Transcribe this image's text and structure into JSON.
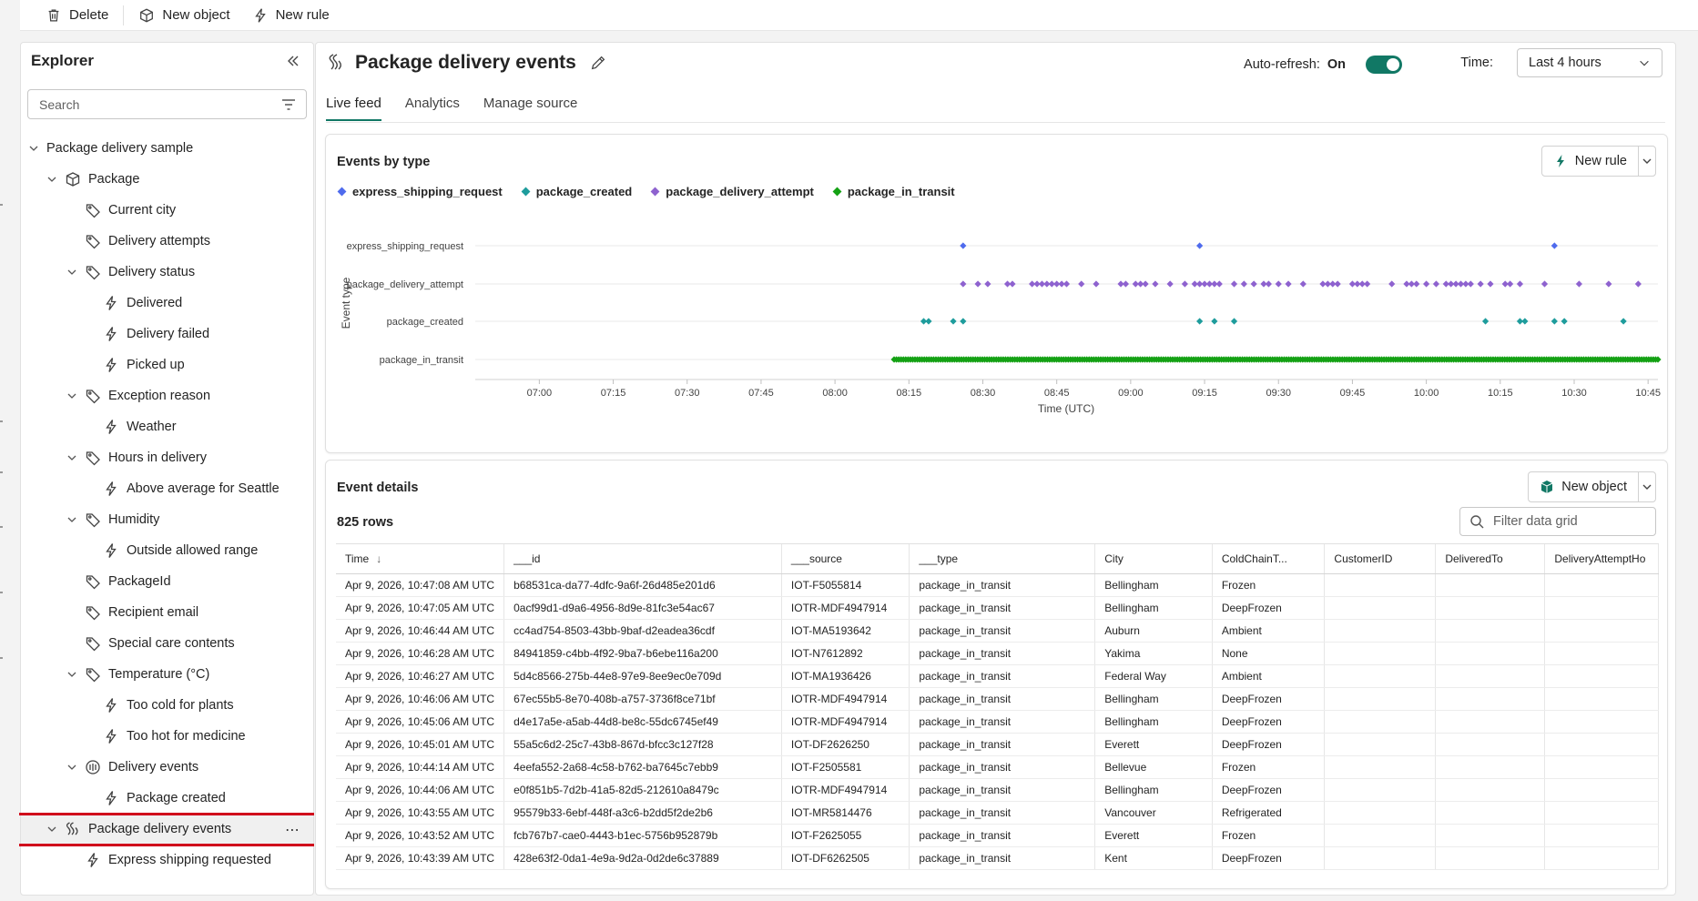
{
  "toolbar": {
    "delete": "Delete",
    "new_object": "New object",
    "new_rule": "New rule"
  },
  "explorer": {
    "title": "Explorer",
    "search_placeholder": "Search",
    "tree": [
      {
        "label": "Package delivery sample",
        "level": 0,
        "chevron": "down",
        "icon": ""
      },
      {
        "label": "Package",
        "level": 1,
        "chevron": "down",
        "icon": "cube-icon"
      },
      {
        "label": "Current city",
        "level": 2,
        "chevron": "",
        "icon": "tag-icon"
      },
      {
        "label": "Delivery attempts",
        "level": 2,
        "chevron": "",
        "icon": "tag-icon"
      },
      {
        "label": "Delivery status",
        "level": 2,
        "chevron": "down",
        "icon": "tag-icon"
      },
      {
        "label": "Delivered",
        "level": 3,
        "chevron": "",
        "icon": "lightning-icon"
      },
      {
        "label": "Delivery failed",
        "level": 3,
        "chevron": "",
        "icon": "lightning-icon"
      },
      {
        "label": "Picked up",
        "level": 3,
        "chevron": "",
        "icon": "lightning-icon"
      },
      {
        "label": "Exception reason",
        "level": 2,
        "chevron": "down",
        "icon": "tag-icon"
      },
      {
        "label": "Weather",
        "level": 3,
        "chevron": "",
        "icon": "lightning-icon"
      },
      {
        "label": "Hours in delivery",
        "level": 2,
        "chevron": "down",
        "icon": "tag-icon"
      },
      {
        "label": "Above average for Seattle",
        "level": 3,
        "chevron": "",
        "icon": "lightning-icon"
      },
      {
        "label": "Humidity",
        "level": 2,
        "chevron": "down",
        "icon": "tag-icon"
      },
      {
        "label": "Outside allowed range",
        "level": 3,
        "chevron": "",
        "icon": "lightning-icon"
      },
      {
        "label": "PackageId",
        "level": 2,
        "chevron": "",
        "icon": "tag-icon"
      },
      {
        "label": "Recipient email",
        "level": 2,
        "chevron": "",
        "icon": "tag-icon"
      },
      {
        "label": "Special care contents",
        "level": 2,
        "chevron": "",
        "icon": "tag-icon"
      },
      {
        "label": "Temperature (°C)",
        "level": 2,
        "chevron": "down",
        "icon": "tag-icon"
      },
      {
        "label": "Too cold for plants",
        "level": 3,
        "chevron": "",
        "icon": "lightning-icon"
      },
      {
        "label": "Too hot for medicine",
        "level": 3,
        "chevron": "",
        "icon": "lightning-icon"
      },
      {
        "label": "Delivery events",
        "level": 2,
        "chevron": "down",
        "icon": "event-stream-icon"
      },
      {
        "label": "Package created",
        "level": 3,
        "chevron": "",
        "icon": "lightning-icon"
      },
      {
        "label": "Package delivery events",
        "level": 1,
        "chevron": "down",
        "icon": "stream-icon",
        "selected": true
      },
      {
        "label": "Express shipping requested",
        "level": 2,
        "chevron": "",
        "icon": "lightning-icon"
      }
    ]
  },
  "main": {
    "title": "Package delivery events",
    "auto_refresh_label": "Auto-refresh:",
    "auto_refresh_value": "On",
    "time_label": "Time:",
    "time_value": "Last 4 hours",
    "tabs": [
      {
        "label": "Live feed",
        "active": true
      },
      {
        "label": "Analytics",
        "active": false
      },
      {
        "label": "Manage source",
        "active": false
      }
    ]
  },
  "events_card": {
    "title": "Events by type",
    "new_rule": "New rule"
  },
  "details_card": {
    "title": "Event details",
    "new_object": "New object",
    "rows_count": "825 rows",
    "filter_placeholder": "Filter data grid",
    "columns": [
      "Time",
      "___id",
      "___source",
      "___type",
      "City",
      "ColdChainT...",
      "CustomerID",
      "DeliveredTo",
      "DeliveryAttemptHo"
    ],
    "rows": [
      [
        "Apr 9, 2026, 10:47:08 AM UTC",
        "b68531ca-da77-4dfc-9a6f-26d485e201d6",
        "IOT-F5055814",
        "package_in_transit",
        "Bellingham",
        "Frozen",
        "",
        "",
        ""
      ],
      [
        "Apr 9, 2026, 10:47:05 AM UTC",
        "0acf99d1-d9a6-4956-8d9e-81fc3e54ac67",
        "IOTR-MDF4947914",
        "package_in_transit",
        "Bellingham",
        "DeepFrozen",
        "",
        "",
        ""
      ],
      [
        "Apr 9, 2026, 10:46:44 AM UTC",
        "cc4ad754-8503-43bb-9baf-d2eadea36cdf",
        "IOT-MA5193642",
        "package_in_transit",
        "Auburn",
        "Ambient",
        "",
        "",
        ""
      ],
      [
        "Apr 9, 2026, 10:46:28 AM UTC",
        "84941859-c4bb-4f92-9ba7-b6ebe116a200",
        "IOT-N7612892",
        "package_in_transit",
        "Yakima",
        "None",
        "",
        "",
        ""
      ],
      [
        "Apr 9, 2026, 10:46:27 AM UTC",
        "5d4c8566-275b-44e8-97e9-8ee9ec0e709d",
        "IOT-MA1936426",
        "package_in_transit",
        "Federal Way",
        "Ambient",
        "",
        "",
        ""
      ],
      [
        "Apr 9, 2026, 10:46:06 AM UTC",
        "67ec55b5-8e70-408b-a757-3736f8ce71bf",
        "IOTR-MDF4947914",
        "package_in_transit",
        "Bellingham",
        "DeepFrozen",
        "",
        "",
        ""
      ],
      [
        "Apr 9, 2026, 10:45:06 AM UTC",
        "d4e17a5e-a5ab-44d8-be8c-55dc6745ef49",
        "IOTR-MDF4947914",
        "package_in_transit",
        "Bellingham",
        "DeepFrozen",
        "",
        "",
        ""
      ],
      [
        "Apr 9, 2026, 10:45:01 AM UTC",
        "55a5c6d2-25c7-43b8-867d-bfcc3c127f28",
        "IOT-DF2626250",
        "package_in_transit",
        "Everett",
        "DeepFrozen",
        "",
        "",
        ""
      ],
      [
        "Apr 9, 2026, 10:44:14 AM UTC",
        "4eefa552-2a68-4c58-b762-ba7645c7ebb9",
        "IOT-F2505581",
        "package_in_transit",
        "Bellevue",
        "Frozen",
        "",
        "",
        ""
      ],
      [
        "Apr 9, 2026, 10:44:06 AM UTC",
        "e0f851b5-7d2b-41a5-82d5-212610a8479c",
        "IOTR-MDF4947914",
        "package_in_transit",
        "Bellingham",
        "DeepFrozen",
        "",
        "",
        ""
      ],
      [
        "Apr 9, 2026, 10:43:55 AM UTC",
        "95579b33-6ebf-448f-a3c6-b2dd5f2de2b6",
        "IOT-MR5814476",
        "package_in_transit",
        "Vancouver",
        "Refrigerated",
        "",
        "",
        ""
      ],
      [
        "Apr 9, 2026, 10:43:52 AM UTC",
        "fcb767b7-cae0-4443-b1ec-5756b952879b",
        "IOT-F2625055",
        "package_in_transit",
        "Everett",
        "Frozen",
        "",
        "",
        ""
      ],
      [
        "Apr 9, 2026, 10:43:39 AM UTC",
        "428e63f2-0da1-4e9a-9d2a-0d2de6c37889",
        "IOT-DF6262505",
        "package_in_transit",
        "Kent",
        "DeepFrozen",
        "",
        "",
        ""
      ]
    ]
  },
  "chart_data": {
    "type": "scatter",
    "title": "Events by type",
    "xlabel": "Time (UTC)",
    "ylabel": "Event type",
    "x_ticks": [
      "07:00",
      "07:15",
      "07:30",
      "07:45",
      "08:00",
      "08:15",
      "08:30",
      "08:45",
      "09:00",
      "09:15",
      "09:30",
      "09:45",
      "10:00",
      "10:15",
      "10:30",
      "10:45"
    ],
    "xlim": [
      "06:47",
      "10:47"
    ],
    "categories": [
      "express_shipping_request",
      "package_delivery_attempt",
      "package_created",
      "package_in_transit"
    ],
    "legend_position": "top-left",
    "grid": "horizontal",
    "series": [
      {
        "name": "express_shipping_request",
        "color": "#4f6bed",
        "x": [
          "08:26",
          "09:14",
          "10:26"
        ]
      },
      {
        "name": "package_created",
        "color": "#1e9c9c",
        "x": [
          "08:18",
          "08:19",
          "08:24",
          "08:26",
          "09:14",
          "09:17",
          "09:21",
          "10:12",
          "10:19",
          "10:20",
          "10:26",
          "10:28",
          "10:40"
        ]
      },
      {
        "name": "package_delivery_attempt",
        "color": "#8e62cf",
        "x": [
          "08:26",
          "08:29",
          "08:31",
          "08:35",
          "08:36",
          "08:40",
          "08:41",
          "08:42",
          "08:43",
          "08:44",
          "08:45",
          "08:46",
          "08:47",
          "08:50",
          "08:53",
          "08:58",
          "08:59",
          "09:01",
          "09:02",
          "09:03",
          "09:05",
          "09:08",
          "09:11",
          "09:13",
          "09:14",
          "09:15",
          "09:16",
          "09:17",
          "09:18",
          "09:21",
          "09:23",
          "09:25",
          "09:27",
          "09:28",
          "09:30",
          "09:32",
          "09:35",
          "09:39",
          "09:40",
          "09:41",
          "09:42",
          "09:45",
          "09:46",
          "09:47",
          "09:48",
          "09:53",
          "09:56",
          "09:57",
          "09:58",
          "10:00",
          "10:02",
          "10:04",
          "10:05",
          "10:06",
          "10:07",
          "10:08",
          "10:09",
          "10:11",
          "10:13",
          "10:16",
          "10:17",
          "10:19",
          "10:24",
          "10:31",
          "10:37",
          "10:43"
        ]
      },
      {
        "name": "package_in_transit",
        "color": "#14a114",
        "x_range": [
          "08:12",
          "10:47"
        ],
        "count": 825
      }
    ]
  }
}
